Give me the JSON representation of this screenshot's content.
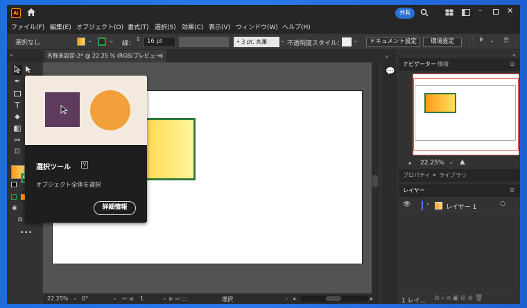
{
  "app": {
    "logo": "Ai",
    "share_label": "共有"
  },
  "menu": [
    "ファイル(F)",
    "編集(E)",
    "オブジェクト(O)",
    "書式(T)",
    "選択(S)",
    "効果(C)",
    "表示(V)",
    "ウィンドウ(W)",
    "ヘルプ(H)"
  ],
  "control": {
    "selection": "選択なし",
    "stroke_label": "線：",
    "stroke_value": "16 pt",
    "brush_value": "3 pt. 丸筆",
    "opacity_label": "不透明度",
    "style_label": "スタイル：",
    "doc_setup_label": "ドキュメント設定",
    "prefs_label": "環境設定"
  },
  "tab": {
    "title": "名称未設定-2* @ 22.25 % (RGB/プレビュー)",
    "close": "×"
  },
  "tooltip": {
    "title": "選択ツール",
    "shortcut": "V",
    "description": "オブジェクト全体を選択",
    "button_label": "詳細情報"
  },
  "status": {
    "zoom": "22.25%",
    "rotation": "0°",
    "artboard": "1",
    "mode": "選択"
  },
  "panels": {
    "nav_tab": "ナビゲーター",
    "info_tab": "情報",
    "nav_zoom": "22.25%",
    "props_tab": "プロパティ",
    "libraries_tab": "ライブラリ",
    "layers_tab": "レイヤー",
    "layer_name": "レイヤー 1",
    "layers_count": "1 レイ..."
  },
  "colors": {
    "accent": "#2b6fd6",
    "artboard_rect_stroke": "#2f7a3e",
    "fill_gradient_start": "#ffd64a",
    "tooltip_square": "#5e3a5c",
    "tooltip_circle": "#f2a13a"
  }
}
